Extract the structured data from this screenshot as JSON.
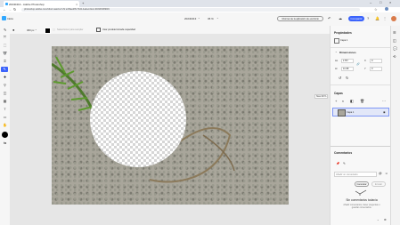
{
  "browser": {
    "tab_title": "20240413 - Adobe Photoshop",
    "url": "photoshop.adobe.com/id/urn:aaid:sc:US:e4f3ae2f8-73d2-4ada-b0e2-4049b53899f4"
  },
  "app": {
    "home_label": "Inicio",
    "doc_name": "20240413",
    "zoom": "36 %",
    "feedback_button": "Informar de la aplicación de escritorio",
    "share_button": "Compartir",
    "tool_options": {
      "size": "360 px",
      "sample_label": "Seleccionar para sampler",
      "preserve_label": "Usar predeterminada capacidad"
    }
  },
  "properties": {
    "title": "Propiedades",
    "layer_label": "Capa 1",
    "dimensions_title": "Dimensiones",
    "w_label": "An",
    "w_value": "1757",
    "h_label": "Al",
    "h_value": "11.98",
    "x_label": "X",
    "x_value": "0",
    "y_label": "Y",
    "y_value": "0"
  },
  "layers": {
    "title": "Capas",
    "tooltip": "Nivel 48 %",
    "items": [
      {
        "name": "Capa 1"
      }
    ]
  },
  "comments": {
    "title": "Comentarios",
    "placeholder": "Añadir un comentario",
    "cancel": "Cancelar",
    "send": "Enviar",
    "empty_title": "Sin comentarios todavía",
    "empty_text": "Añadir comentarios, hacer preguntas o guardar comentarios."
  },
  "colors": {
    "accent": "#3b63fb",
    "foreground": "#000000"
  }
}
